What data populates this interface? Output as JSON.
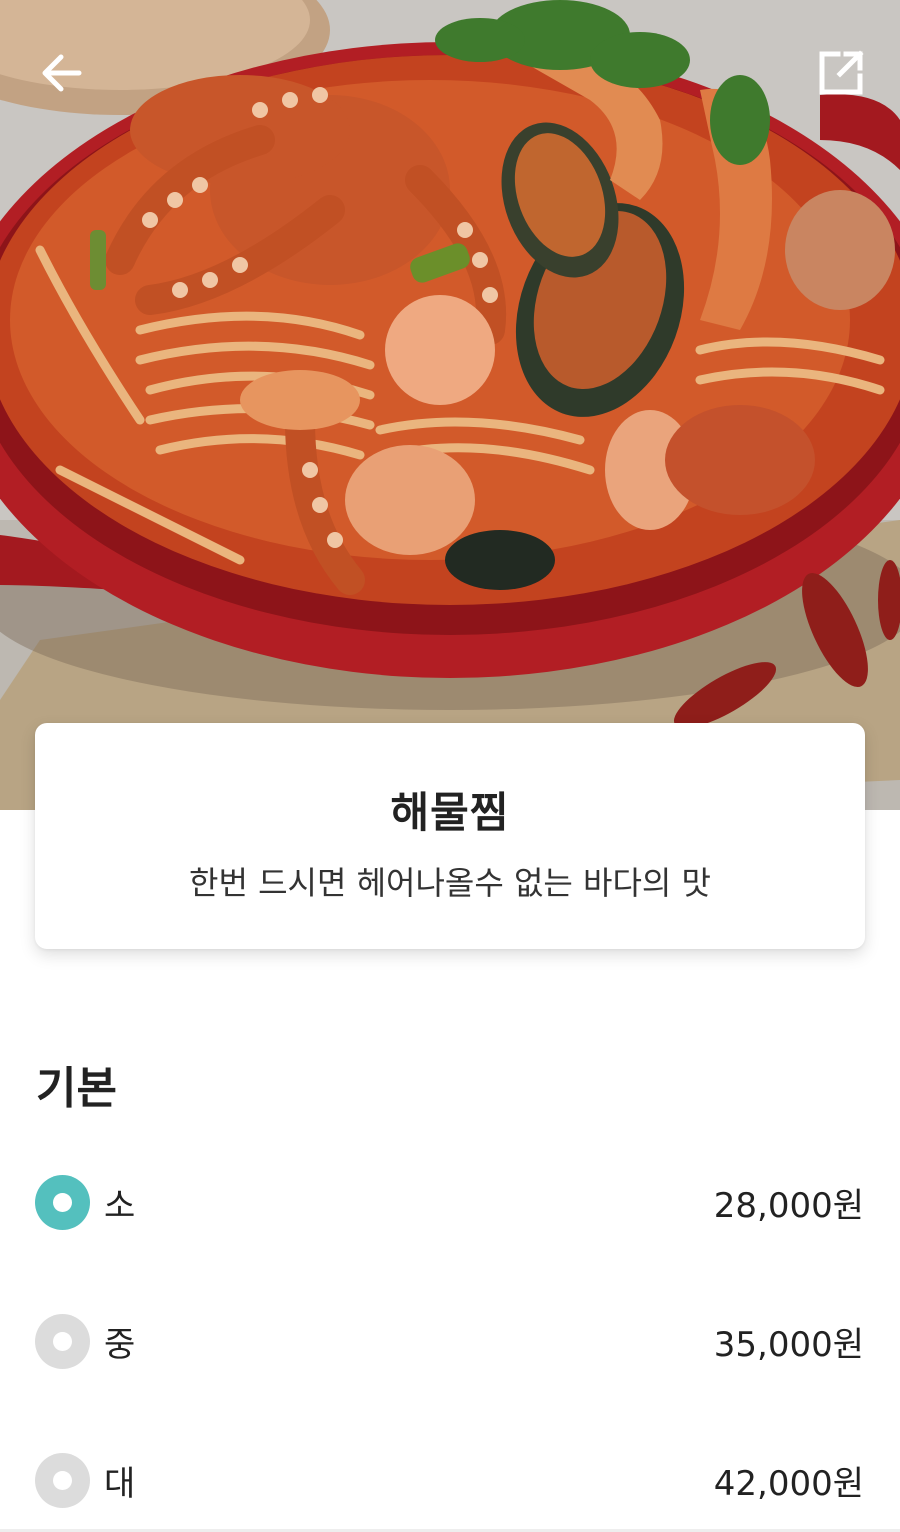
{
  "header": {
    "back_icon": "arrow-left-icon",
    "share_icon": "share-external-icon"
  },
  "menu": {
    "name": "해물찜",
    "description": "한번 드시면 헤어나올수 없는 바다의 맛"
  },
  "options_section": {
    "title": "기본",
    "options": [
      {
        "label": "소",
        "price": "28,000원",
        "selected": true
      },
      {
        "label": "중",
        "price": "35,000원",
        "selected": false
      },
      {
        "label": "대",
        "price": "42,000원",
        "selected": false
      }
    ]
  },
  "colors": {
    "accent": "#54c0be",
    "radio_inactive": "#dcdcdc",
    "pan_red": "#b21e24"
  }
}
